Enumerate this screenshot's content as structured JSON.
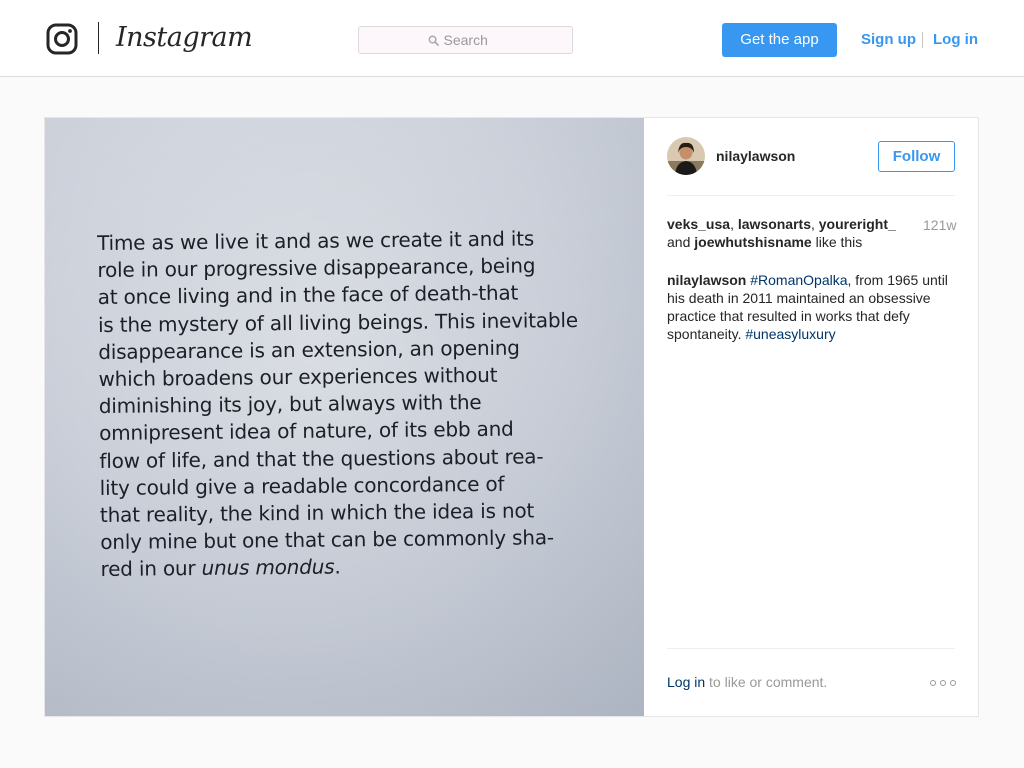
{
  "header": {
    "brand_wordmark": "Instagram",
    "search": {
      "placeholder": "Search",
      "value": ""
    },
    "get_app_label": "Get the app",
    "signup_label": "Sign up",
    "login_label": "Log in"
  },
  "post": {
    "photo_text": {
      "lines": [
        "Time as we live it and as we create it and its",
        "role in our progressive disappearance, being",
        "at once living and in the face of death-that",
        "is the mystery of all living beings. This inevitable",
        "disappearance is an extension, an opening",
        "which broadens our experiences without",
        "diminishing its joy, but always with the",
        "omnipresent idea of nature, of its ebb and",
        "flow of life, and that the questions about rea-",
        "lity could give a readable concordance of",
        "that reality, the kind in which the idea is not",
        "only mine but one that can be commonly sha-"
      ],
      "last_line_prefix": "red in our ",
      "last_line_italic": "unus mondus",
      "last_line_suffix": "."
    },
    "author": {
      "username": "nilaylawson",
      "follow_label": "Follow"
    },
    "likes": {
      "user1": "veks_usa",
      "sep1": ", ",
      "user2": "lawsonarts",
      "sep2": ", ",
      "user3": "youreright_",
      "and_text": "and ",
      "user4": "joewhutshisname",
      "suffix": " like this"
    },
    "timestamp": "121w",
    "caption": {
      "username": "nilaylawson",
      "hashtag1": "#RomanOpalka",
      "text": ", from 1965 until his death in 2011 maintained an obsessive practice that resulted in works that defy spontaneity. ",
      "hashtag2": "#uneasyluxury"
    },
    "comment_prompt": {
      "login_label": "Log in",
      "text": " to like or comment."
    }
  },
  "colors": {
    "accent": "#3897f0",
    "hashtag": "#003569",
    "muted": "#999999"
  },
  "icons": [
    "instagram-camera-icon",
    "search-icon",
    "more-options-icon"
  ]
}
